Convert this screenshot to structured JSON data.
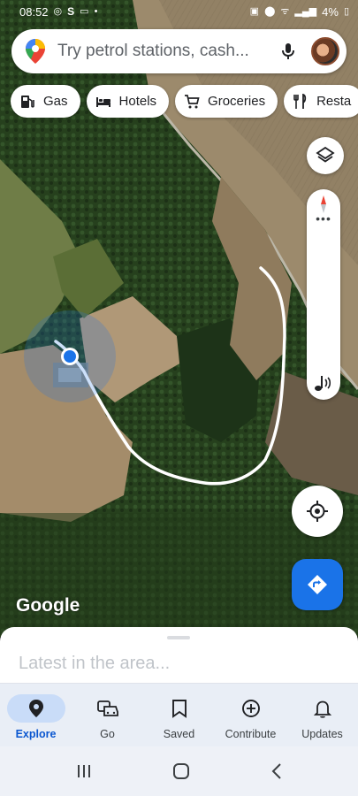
{
  "status_bar": {
    "time": "08:52",
    "battery": "4%",
    "left_icons": [
      "whatsapp-icon",
      "s-icon",
      "sim-icon",
      "dot-icon"
    ],
    "right_icons": [
      "lock-icon",
      "location-icon",
      "wifi-icon",
      "lte-signal-icon",
      "battery-icon"
    ]
  },
  "search": {
    "placeholder": "Try petrol stations, cash..."
  },
  "chips": [
    {
      "label": "Gas",
      "icon": "gas-station-icon"
    },
    {
      "label": "Hotels",
      "icon": "bed-icon"
    },
    {
      "label": "Groceries",
      "icon": "cart-icon"
    },
    {
      "label": "Resta",
      "icon": "restaurant-icon"
    }
  ],
  "map": {
    "attribution": "Google",
    "route_color": "#ffffff",
    "location_dot_color": "#1a73e8"
  },
  "sheet": {
    "title": "Latest in the area..."
  },
  "bottom_nav": {
    "items": [
      {
        "label": "Explore",
        "icon": "location-pin-icon",
        "active": true
      },
      {
        "label": "Go",
        "icon": "commute-icon",
        "active": false
      },
      {
        "label": "Saved",
        "icon": "bookmark-icon",
        "active": false
      },
      {
        "label": "Contribute",
        "icon": "add-circle-icon",
        "active": false
      },
      {
        "label": "Updates",
        "icon": "bell-icon",
        "active": false
      }
    ]
  },
  "colors": {
    "accent": "#1a73e8",
    "active_nav_bg": "#c9dcf8",
    "active_nav_text": "#0b57d0"
  }
}
